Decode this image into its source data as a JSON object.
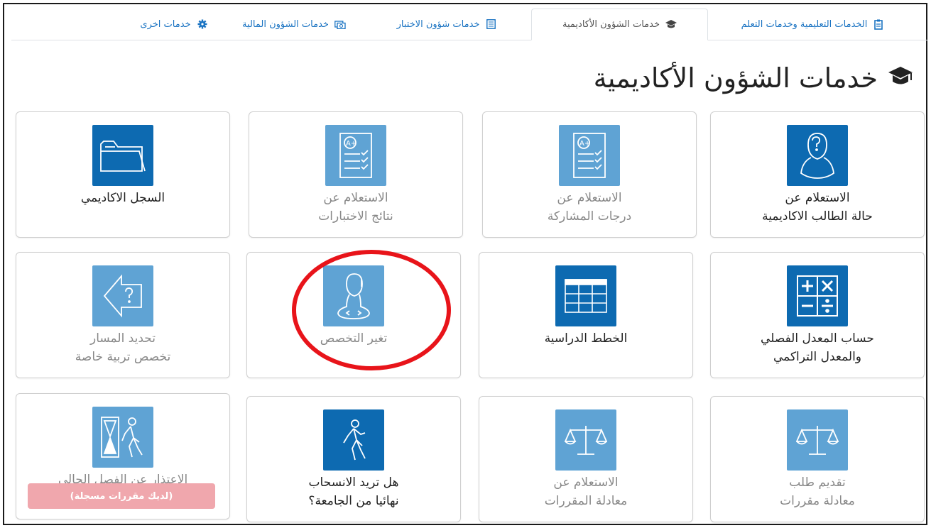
{
  "tabs": [
    {
      "label": "الخدمات التعليمية وخدمات التعلم",
      "icon": "clipboard-icon"
    },
    {
      "label": "خدمات الشؤون الأكاديمية",
      "icon": "graduation-cap-icon"
    },
    {
      "label": "خدمات شؤون الاختبار",
      "icon": "exam-sheet-icon"
    },
    {
      "label": "خدمات الشؤون المالية",
      "icon": "money-icon"
    },
    {
      "label": "خدمات اخرى",
      "icon": "gear-icon"
    }
  ],
  "active_tab": "خدمات الشؤون الأكاديمية",
  "page": {
    "title": "خدمات الشؤون الأكاديمية",
    "title_icon": "graduation-cap-icon"
  },
  "cards": [
    {
      "line1": "الاستعلام عن",
      "line2": "حالة الطالب الاكاديمية",
      "icon": "student-question-icon",
      "enabled": true
    },
    {
      "line1": "الاستعلام عن",
      "line2": "درجات المشاركة",
      "icon": "graded-sheet-icon",
      "enabled": false
    },
    {
      "line1": "الاستعلام عن",
      "line2": "نتائج الاختبارات",
      "icon": "graded-sheet-icon",
      "enabled": false
    },
    {
      "line1": "السجل الاكاديمي",
      "line2": "",
      "icon": "folder-icon",
      "enabled": true
    },
    {
      "line1": "حساب المعدل الفصلي",
      "line2": "والمعدل التراكمي",
      "icon": "calculator-icon",
      "enabled": true
    },
    {
      "line1": "الخطط الدراسية",
      "line2": "",
      "icon": "table-icon",
      "enabled": true
    },
    {
      "line1": "تغير التخصص",
      "line2": "",
      "icon": "student-switch-icon",
      "enabled": false
    },
    {
      "line1": "تحديد المسار",
      "line2": "تخصص تربية خاصة",
      "icon": "direction-question-icon",
      "enabled": false
    },
    {
      "line1": "تقديم طلب",
      "line2": "معادلة مقررات",
      "icon": "balance-scale-icon",
      "enabled": false
    },
    {
      "line1": "الاستعلام عن",
      "line2": "معادلة المقررات",
      "icon": "balance-scale-icon",
      "enabled": false
    },
    {
      "line1": "هل تريد الانسحاب",
      "line2": "نهائيا من الجامعة؟",
      "icon": "walking-person-icon",
      "enabled": true
    },
    {
      "line1": "الاعتذار عن الفصل الحالي",
      "line2": "",
      "icon": "hourglass-person-icon",
      "enabled": false,
      "badge": "(لديك مقررات مسجلة)"
    }
  ],
  "colors": {
    "icon_box": "#0d6ab1",
    "icon_box_faded": "#5fa3d4",
    "tab_link": "#1a73c2",
    "badge_bg": "#f0a7ad",
    "highlight_circle": "#e8141a"
  }
}
